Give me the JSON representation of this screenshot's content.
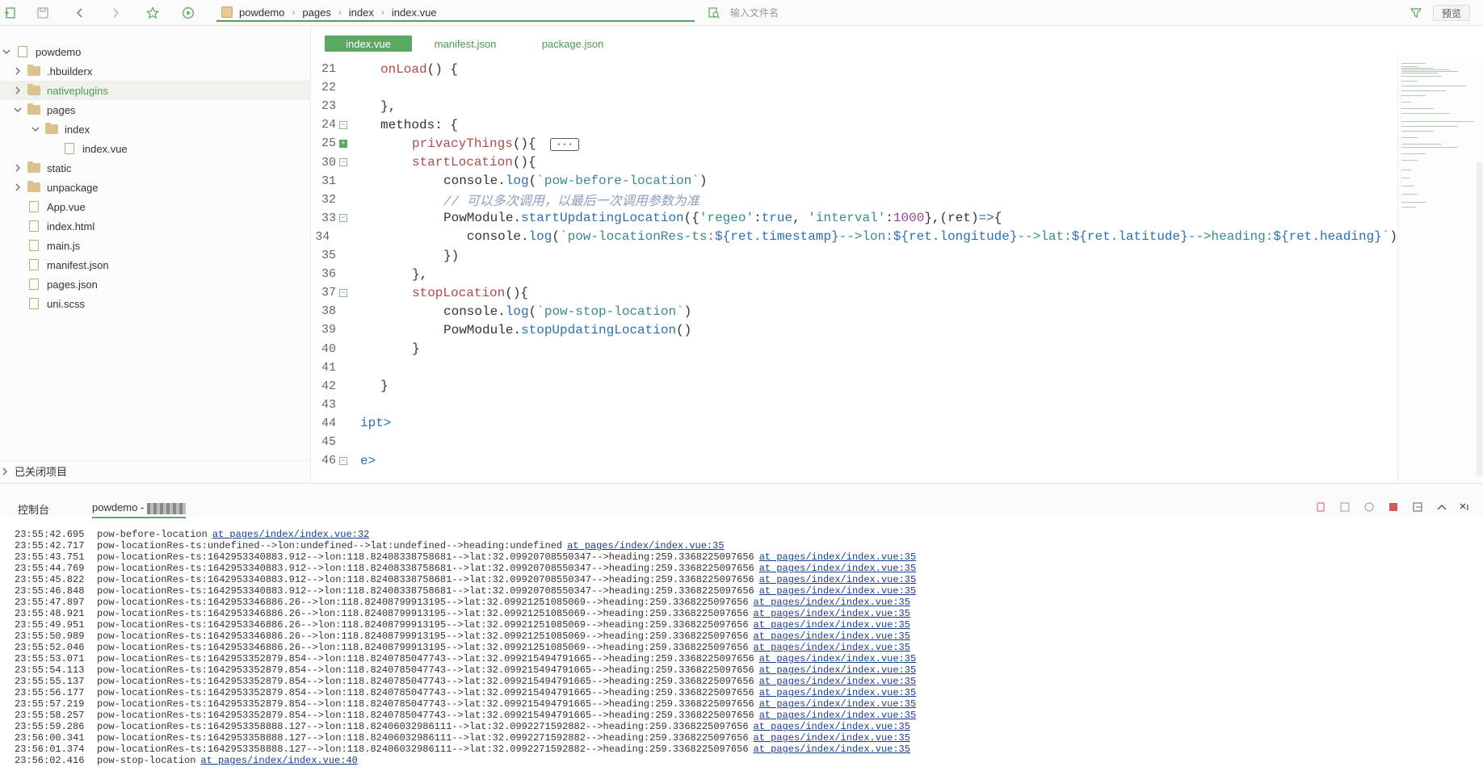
{
  "toolbar": {
    "breadcrumb": [
      "powdemo",
      "pages",
      "index",
      "index.vue"
    ],
    "search_placeholder": "输入文件名",
    "preview_label": "预览"
  },
  "sidebar": {
    "items": [
      {
        "label": "powdemo",
        "type": "project",
        "depth": 0,
        "expanded": true
      },
      {
        "label": ".hbuilderx",
        "type": "folder",
        "depth": 1,
        "expanded": false
      },
      {
        "label": "nativeplugins",
        "type": "folder",
        "depth": 1,
        "expanded": false,
        "selected": true
      },
      {
        "label": "pages",
        "type": "folder",
        "depth": 1,
        "expanded": true
      },
      {
        "label": "index",
        "type": "folder",
        "depth": 2,
        "expanded": true
      },
      {
        "label": "index.vue",
        "type": "file",
        "depth": 3
      },
      {
        "label": "static",
        "type": "folder",
        "depth": 1,
        "expanded": false
      },
      {
        "label": "unpackage",
        "type": "folder",
        "depth": 1,
        "expanded": false
      },
      {
        "label": "App.vue",
        "type": "file",
        "depth": 1
      },
      {
        "label": "index.html",
        "type": "file-html",
        "depth": 1
      },
      {
        "label": "main.js",
        "type": "file",
        "depth": 1
      },
      {
        "label": "manifest.json",
        "type": "file-json",
        "depth": 1
      },
      {
        "label": "pages.json",
        "type": "file-bracket",
        "depth": 1
      },
      {
        "label": "uni.scss",
        "type": "file-scss",
        "depth": 1
      }
    ],
    "closed_projects_label": "已关闭项目"
  },
  "editor": {
    "tabs": [
      "index.vue",
      "manifest.json",
      "package.json"
    ],
    "active_tab": 0,
    "lines": [
      {
        "n": "21",
        "fold": "",
        "indent": 1,
        "html": "<span class='kw-fn'>onLoad</span>() {"
      },
      {
        "n": "22",
        "fold": "",
        "indent": 0,
        "html": ""
      },
      {
        "n": "23",
        "fold": "",
        "indent": 1,
        "html": "},"
      },
      {
        "n": "24",
        "fold": "-",
        "indent": 1,
        "html": "methods: {"
      },
      {
        "n": "25",
        "fold": "+",
        "indent": 2,
        "html": "<span class='kw-fn'>privacyThings</span>(){ <span class='ellipsis'>···</span>"
      },
      {
        "n": "30",
        "fold": "-",
        "indent": 2,
        "html": "<span class='kw-fn'>startLocation</span>(){"
      },
      {
        "n": "31",
        "fold": "",
        "indent": 3,
        "html": "console.<span class='kw-call'>log</span>(<span class='str'>`pow-before-location`</span>)"
      },
      {
        "n": "32",
        "fold": "",
        "indent": 3,
        "html": "<span class='comment'>// 可以多次调用，以最后一次调用参数为准</span>"
      },
      {
        "n": "33",
        "fold": "-",
        "indent": 3,
        "html": "PowModule.<span class='kw-call'>startUpdatingLocation</span>({<span class='str'>'regeo'</span>:<span class='kw-true'>true</span>, <span class='str'>'interval'</span>:<span class='num'>1000</span>},(ret)<span class='kw-call'>=&gt;</span>{"
      },
      {
        "n": "34",
        "fold": "",
        "indent": 4,
        "html": "console.<span class='kw-call'>log</span>(<span class='str'>`pow-locationRes-ts:</span><span class='kw-call'>${ret.timestamp}</span><span class='str'>--&gt;lon:</span><span class='kw-call'>${ret.longitude}</span><span class='str'>--&gt;lat:</span><span class='kw-call'>${ret.latitude}</span><span class='str'>--&gt;heading:</span><span class='kw-call'>${ret.heading}</span><span class='str'>`</span>)"
      },
      {
        "n": "35",
        "fold": "",
        "indent": 3,
        "html": "})"
      },
      {
        "n": "36",
        "fold": "",
        "indent": 2,
        "html": "},"
      },
      {
        "n": "37",
        "fold": "-",
        "indent": 2,
        "html": "<span class='kw-fn'>stopLocation</span>(){"
      },
      {
        "n": "38",
        "fold": "",
        "indent": 3,
        "html": "console.<span class='kw-call'>log</span>(<span class='str'>`pow-stop-location`</span>)"
      },
      {
        "n": "39",
        "fold": "",
        "indent": 3,
        "html": "PowModule.<span class='kw-call'>stopUpdatingLocation</span>()"
      },
      {
        "n": "40",
        "fold": "",
        "indent": 2,
        "html": "}"
      },
      {
        "n": "41",
        "fold": "",
        "indent": 0,
        "html": ""
      },
      {
        "n": "42",
        "fold": "",
        "indent": 1,
        "html": "}"
      },
      {
        "n": "43",
        "fold": "",
        "indent": 0,
        "html": ""
      },
      {
        "n": "44",
        "fold": "",
        "indent": 0,
        "html": "<span class='kw-call'>ipt&gt;</span>"
      },
      {
        "n": "45",
        "fold": "",
        "indent": 0,
        "html": ""
      },
      {
        "n": "46",
        "fold": "-",
        "indent": 0,
        "html": "<span class='kw-call'>e&gt;</span>"
      }
    ]
  },
  "console": {
    "tab_console": "控制台",
    "tab_project": "powdemo -",
    "logs": [
      {
        "t": "23:55:42.695",
        "m": "pow-before-location",
        "l": "at pages/index/index.vue:32"
      },
      {
        "t": "23:55:42.717",
        "m": "pow-locationRes-ts:undefined-->lon:undefined-->lat:undefined-->heading:undefined",
        "l": "at pages/index/index.vue:35"
      },
      {
        "t": "23:55:43.751",
        "m": "pow-locationRes-ts:1642953340883.912-->lon:118.82408338758681-->lat:32.09920708550347-->heading:259.3368225097656",
        "l": "at pages/index/index.vue:35"
      },
      {
        "t": "23:55:44.769",
        "m": "pow-locationRes-ts:1642953340883.912-->lon:118.82408338758681-->lat:32.09920708550347-->heading:259.3368225097656",
        "l": "at pages/index/index.vue:35"
      },
      {
        "t": "23:55:45.822",
        "m": "pow-locationRes-ts:1642953340883.912-->lon:118.82408338758681-->lat:32.09920708550347-->heading:259.3368225097656",
        "l": "at pages/index/index.vue:35"
      },
      {
        "t": "23:55:46.848",
        "m": "pow-locationRes-ts:1642953340883.912-->lon:118.82408338758681-->lat:32.09920708550347-->heading:259.3368225097656",
        "l": "at pages/index/index.vue:35"
      },
      {
        "t": "23:55:47.897",
        "m": "pow-locationRes-ts:1642953346886.26-->lon:118.82408799913195-->lat:32.09921251085069-->heading:259.3368225097656",
        "l": "at pages/index/index.vue:35"
      },
      {
        "t": "23:55:48.921",
        "m": "pow-locationRes-ts:1642953346886.26-->lon:118.82408799913195-->lat:32.09921251085069-->heading:259.3368225097656",
        "l": "at pages/index/index.vue:35"
      },
      {
        "t": "23:55:49.951",
        "m": "pow-locationRes-ts:1642953346886.26-->lon:118.82408799913195-->lat:32.09921251085069-->heading:259.3368225097656",
        "l": "at pages/index/index.vue:35"
      },
      {
        "t": "23:55:50.989",
        "m": "pow-locationRes-ts:1642953346886.26-->lon:118.82408799913195-->lat:32.09921251085069-->heading:259.3368225097656",
        "l": "at pages/index/index.vue:35"
      },
      {
        "t": "23:55:52.046",
        "m": "pow-locationRes-ts:1642953346886.26-->lon:118.82408799913195-->lat:32.09921251085069-->heading:259.3368225097656",
        "l": "at pages/index/index.vue:35"
      },
      {
        "t": "23:55:53.071",
        "m": "pow-locationRes-ts:1642953352879.854-->lon:118.8240785047743-->lat:32.099215494791665-->heading:259.3368225097656",
        "l": "at pages/index/index.vue:35"
      },
      {
        "t": "23:55:54.113",
        "m": "pow-locationRes-ts:1642953352879.854-->lon:118.8240785047743-->lat:32.099215494791665-->heading:259.3368225097656",
        "l": "at pages/index/index.vue:35"
      },
      {
        "t": "23:55:55.137",
        "m": "pow-locationRes-ts:1642953352879.854-->lon:118.8240785047743-->lat:32.099215494791665-->heading:259.3368225097656",
        "l": "at pages/index/index.vue:35"
      },
      {
        "t": "23:55:56.177",
        "m": "pow-locationRes-ts:1642953352879.854-->lon:118.8240785047743-->lat:32.099215494791665-->heading:259.3368225097656",
        "l": "at pages/index/index.vue:35"
      },
      {
        "t": "23:55:57.219",
        "m": "pow-locationRes-ts:1642953352879.854-->lon:118.8240785047743-->lat:32.099215494791665-->heading:259.3368225097656",
        "l": "at pages/index/index.vue:35"
      },
      {
        "t": "23:55:58.257",
        "m": "pow-locationRes-ts:1642953352879.854-->lon:118.8240785047743-->lat:32.099215494791665-->heading:259.3368225097656",
        "l": "at pages/index/index.vue:35"
      },
      {
        "t": "23:55:59.286",
        "m": "pow-locationRes-ts:1642953358888.127-->lon:118.82406032986111-->lat:32.0992271592882-->heading:259.3368225097656",
        "l": "at pages/index/index.vue:35"
      },
      {
        "t": "23:56:00.341",
        "m": "pow-locationRes-ts:1642953358888.127-->lon:118.82406032986111-->lat:32.0992271592882-->heading:259.3368225097656",
        "l": "at pages/index/index.vue:35"
      },
      {
        "t": "23:56:01.374",
        "m": "pow-locationRes-ts:1642953358888.127-->lon:118.82406032986111-->lat:32.0992271592882-->heading:259.3368225097656",
        "l": "at pages/index/index.vue:35"
      },
      {
        "t": "23:56:02.416",
        "m": "pow-stop-location",
        "l": "at pages/index/index.vue:40"
      }
    ]
  },
  "colors": {
    "accent_green": "#5ba862",
    "link_blue": "#1a3d8f"
  }
}
